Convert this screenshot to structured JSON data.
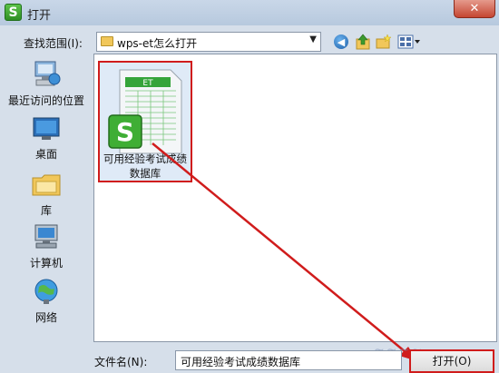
{
  "window": {
    "title": "打开",
    "app_icon_glyph": "S",
    "close_glyph": "✕"
  },
  "lookin": {
    "label": "查找范围(I):",
    "value": "wps-et怎么打开"
  },
  "toolbar": {
    "back_glyph": "◀",
    "icons": [
      "back-icon",
      "up-folder-icon",
      "new-folder-icon",
      "views-menu-icon"
    ]
  },
  "places": [
    {
      "label": "最近访问的位置",
      "icon": "recent-places-icon"
    },
    {
      "label": "桌面",
      "icon": "desktop-icon"
    },
    {
      "label": "库",
      "icon": "libraries-icon"
    },
    {
      "label": "计算机",
      "icon": "computer-icon"
    },
    {
      "label": "网络",
      "icon": "network-icon"
    }
  ],
  "file": {
    "badge": "ET",
    "logo": "S",
    "name_line1": "可用经验考试成绩",
    "name_line2": "数据库"
  },
  "filename": {
    "label": "文件名(N):",
    "value": "可用经验考试成绩数据库"
  },
  "open_button": {
    "label": "打开(O)"
  },
  "annotation": {
    "color": "#d01c1c"
  }
}
